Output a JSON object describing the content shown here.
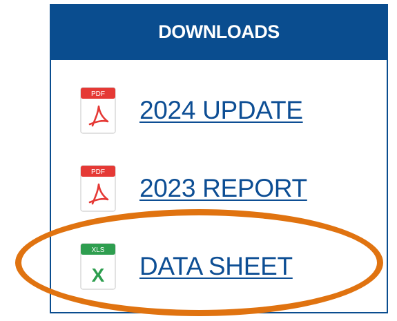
{
  "downloads": {
    "header": "DOWNLOADS",
    "items": [
      {
        "label": "2024 UPDATE",
        "file_type": "PDF",
        "icon": "pdf-file-icon",
        "badge_color": "#e53935",
        "mark": "acrobat"
      },
      {
        "label": "2023 REPORT",
        "file_type": "PDF",
        "icon": "pdf-file-icon",
        "badge_color": "#e53935",
        "mark": "acrobat"
      },
      {
        "label": "DATA SHEET",
        "file_type": "XLS",
        "icon": "xls-file-icon",
        "badge_color": "#2e9e4f",
        "mark": "X"
      }
    ]
  },
  "highlight": {
    "target": "DATA SHEET",
    "color": "#e07310"
  },
  "colors": {
    "header_bg": "#0a4d8f",
    "link": "#0d4e94"
  }
}
